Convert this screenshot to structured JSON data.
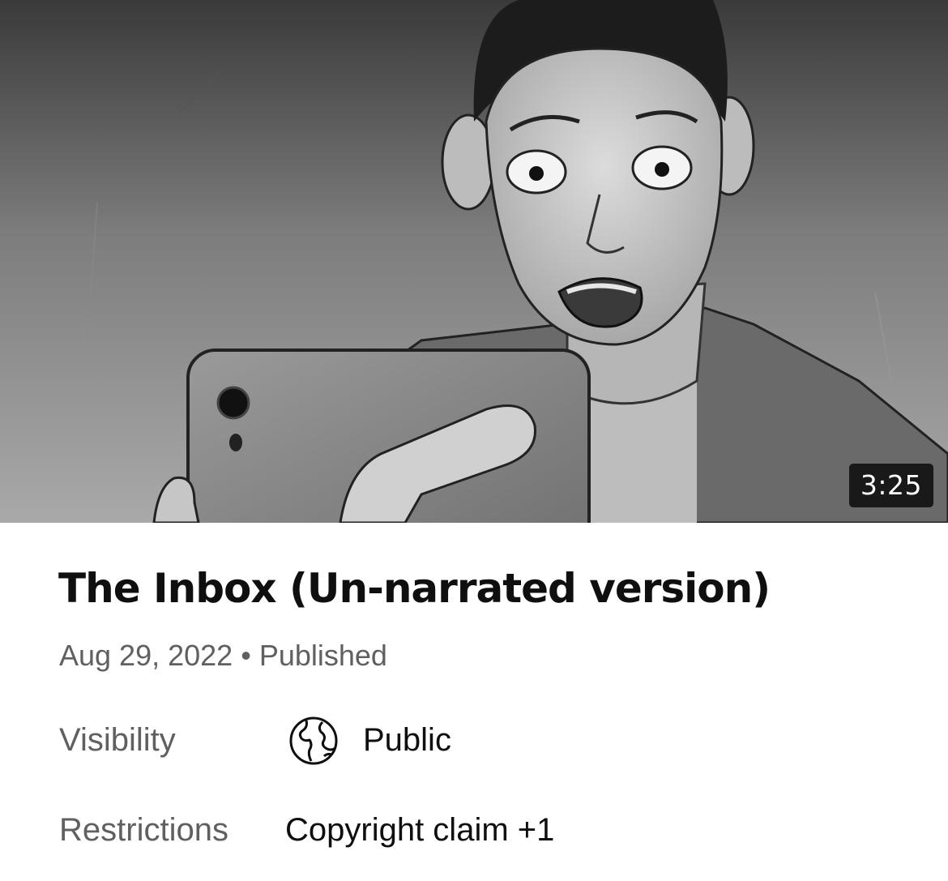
{
  "video": {
    "duration": "3:25",
    "title": "The Inbox (Un-narrated version)",
    "date": "Aug 29, 2022",
    "separator": "•",
    "status": "Published"
  },
  "details": {
    "visibility_label": "Visibility",
    "visibility_value": "Public",
    "visibility_icon": "globe-icon",
    "restrictions_label": "Restrictions",
    "restrictions_value": "Copyright claim +1"
  }
}
